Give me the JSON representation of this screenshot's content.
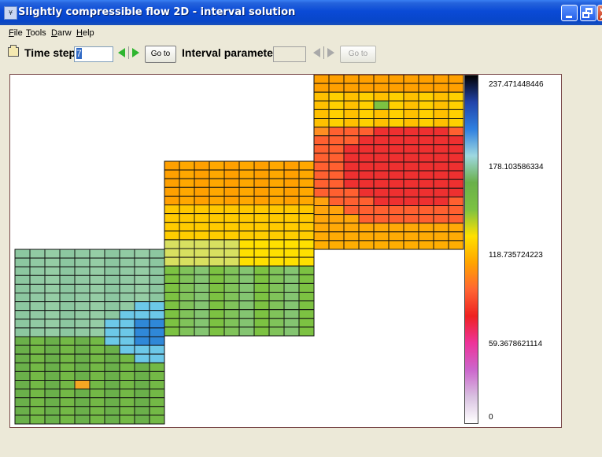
{
  "window": {
    "title": "Slightly compressible flow 2D - interval solution",
    "icon": "app-icon"
  },
  "menu": [
    "File",
    "Tools",
    "Darw",
    "Help"
  ],
  "toolbar": {
    "time_step_label": "Time step",
    "time_step_value": "7",
    "goto_label": "Go to",
    "interval_label": "Interval parameter",
    "interval_value": "",
    "goto2_label": "Go to"
  },
  "chart_data": {
    "type": "heatmap",
    "colorbar_ticks": [
      "237.471448446",
      "178.103586334",
      "118.735724223",
      "59.3678621114",
      "0"
    ],
    "colorbar_values": [
      237.471448446,
      178.103586334,
      118.735724223,
      59.3678621114,
      0
    ],
    "colormap": [
      "#ffffff",
      "#d8c0e0",
      "#cc66cc",
      "#ee3399",
      "#ee2222",
      "#ff6633",
      "#ffa500",
      "#ffe000",
      "#7cc242",
      "#6ab04a",
      "#9ed8e0",
      "#2f80e0",
      "#2244aa",
      "#000000"
    ],
    "blocks": [
      {
        "name": "lower-left",
        "cols": 10,
        "rows": 20,
        "colors": [
          "#8cc7a0",
          "#7cc242",
          "#44aadd",
          "#f5a623"
        ]
      },
      {
        "name": "middle",
        "cols": 10,
        "rows": 20,
        "colors": [
          "#ffa000",
          "#ffe000",
          "#7cc242",
          "#8cc7a0"
        ]
      },
      {
        "name": "upper-right",
        "cols": 10,
        "rows": 20,
        "colors": [
          "#ffe000",
          "#ffa000",
          "#ff5030",
          "#ee3030"
        ]
      }
    ]
  }
}
